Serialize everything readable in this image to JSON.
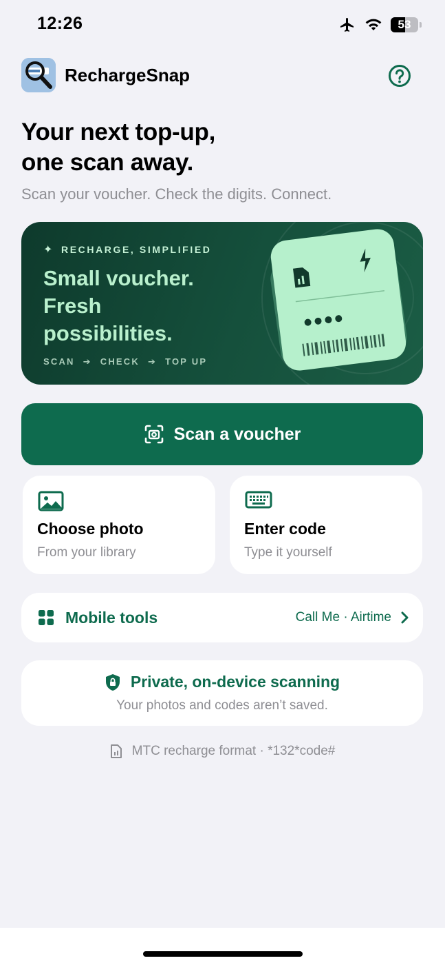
{
  "status": {
    "time": "12:26",
    "battery": "53",
    "battery_level": 0.53
  },
  "header": {
    "app_name": "RechargeSnap",
    "help_icon": "help-circle-icon"
  },
  "intro": {
    "headline_line1": "Your next top-up,",
    "headline_line2": "one scan away.",
    "subline": "Scan your voucher. Check the digits. Connect."
  },
  "hero": {
    "eyebrow": "RECHARGE, SIMPLIFIED",
    "title_line1": "Small voucher.",
    "title_line2": "Fresh",
    "title_line3": "possibilities.",
    "steps": [
      "SCAN",
      "CHECK",
      "TOP UP"
    ]
  },
  "actions": {
    "scan_label": "Scan a voucher",
    "choose_photo_title": "Choose photo",
    "choose_photo_sub": "From your library",
    "enter_code_title": "Enter code",
    "enter_code_sub": "Type it yourself"
  },
  "tools": {
    "title": "Mobile tools",
    "right_label": "Call Me · Airtime"
  },
  "privacy": {
    "title": "Private, on-device scanning",
    "subtitle": "Your photos and codes aren’t saved."
  },
  "footer": {
    "note": "MTC recharge format · *132*code#"
  },
  "colors": {
    "brand": "#0e6b4e",
    "background": "#f2f2f7",
    "hero": "#14493a",
    "accent_light": "#b6f0cc"
  }
}
